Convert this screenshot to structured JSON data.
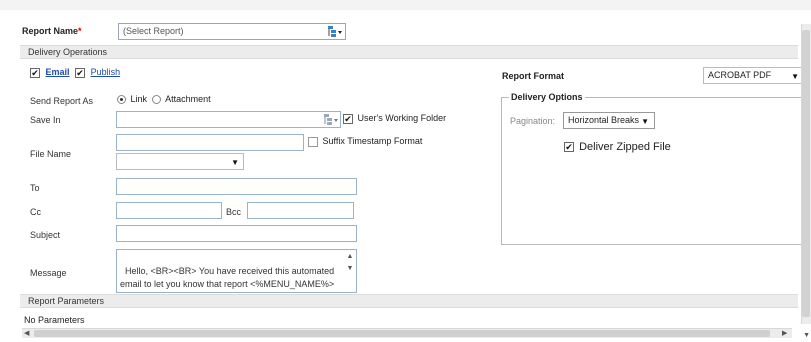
{
  "header": {
    "report_name_label": "Report Name",
    "required_mark": "*",
    "report_select_value": "(Select Report)"
  },
  "sections": {
    "delivery_operations": "Delivery Operations",
    "report_parameters": "Report Parameters"
  },
  "delivery": {
    "email_label": "Email",
    "publish_label": "Publish"
  },
  "form": {
    "send_report_as_label": "Send Report As",
    "link_label": "Link",
    "attachment_label": "Attachment",
    "save_in_label": "Save In",
    "save_in_value": "",
    "users_working_folder_label": "User's Working Folder",
    "file_name_label": "File Name",
    "file_name_value": "",
    "suffix_timestamp_label": "Suffix Timestamp Format",
    "suffix_format_value": "",
    "to_label": "To",
    "to_value": "",
    "cc_label": "Cc",
    "cc_value": "",
    "bcc_label": "Bcc",
    "bcc_value": "",
    "subject_label": "Subject",
    "subject_value": "",
    "message_label": "Message",
    "message_value": "Hello, <BR><BR> You have received this automated email to let you know that report <%MENU_NAME%> has been generated.Please click the following link to view the report"
  },
  "report_format": {
    "label": "Report Format",
    "value": "ACROBAT PDF"
  },
  "delivery_options": {
    "legend": "Delivery Options",
    "pagination_label": "Pagination:",
    "pagination_value": "Horizontal Breaks",
    "deliver_zipped_label": "Deliver Zipped File"
  },
  "parameters": {
    "none_text": "No Parameters"
  },
  "icons": {
    "report_select": "tree-dropdown-icon",
    "save_in_browse": "tree-dropdown-icon",
    "dropdown": "caret-down-icon",
    "checkmark": "check-icon",
    "scroll_left": "arrow-left-icon",
    "scroll_right": "arrow-right-icon",
    "scroll_up": "arrow-up-icon",
    "scroll_down": "arrow-down-icon"
  },
  "colors": {
    "required": "#d40000",
    "link": "#1f4aa8",
    "input_border": "#9bb3c9"
  }
}
